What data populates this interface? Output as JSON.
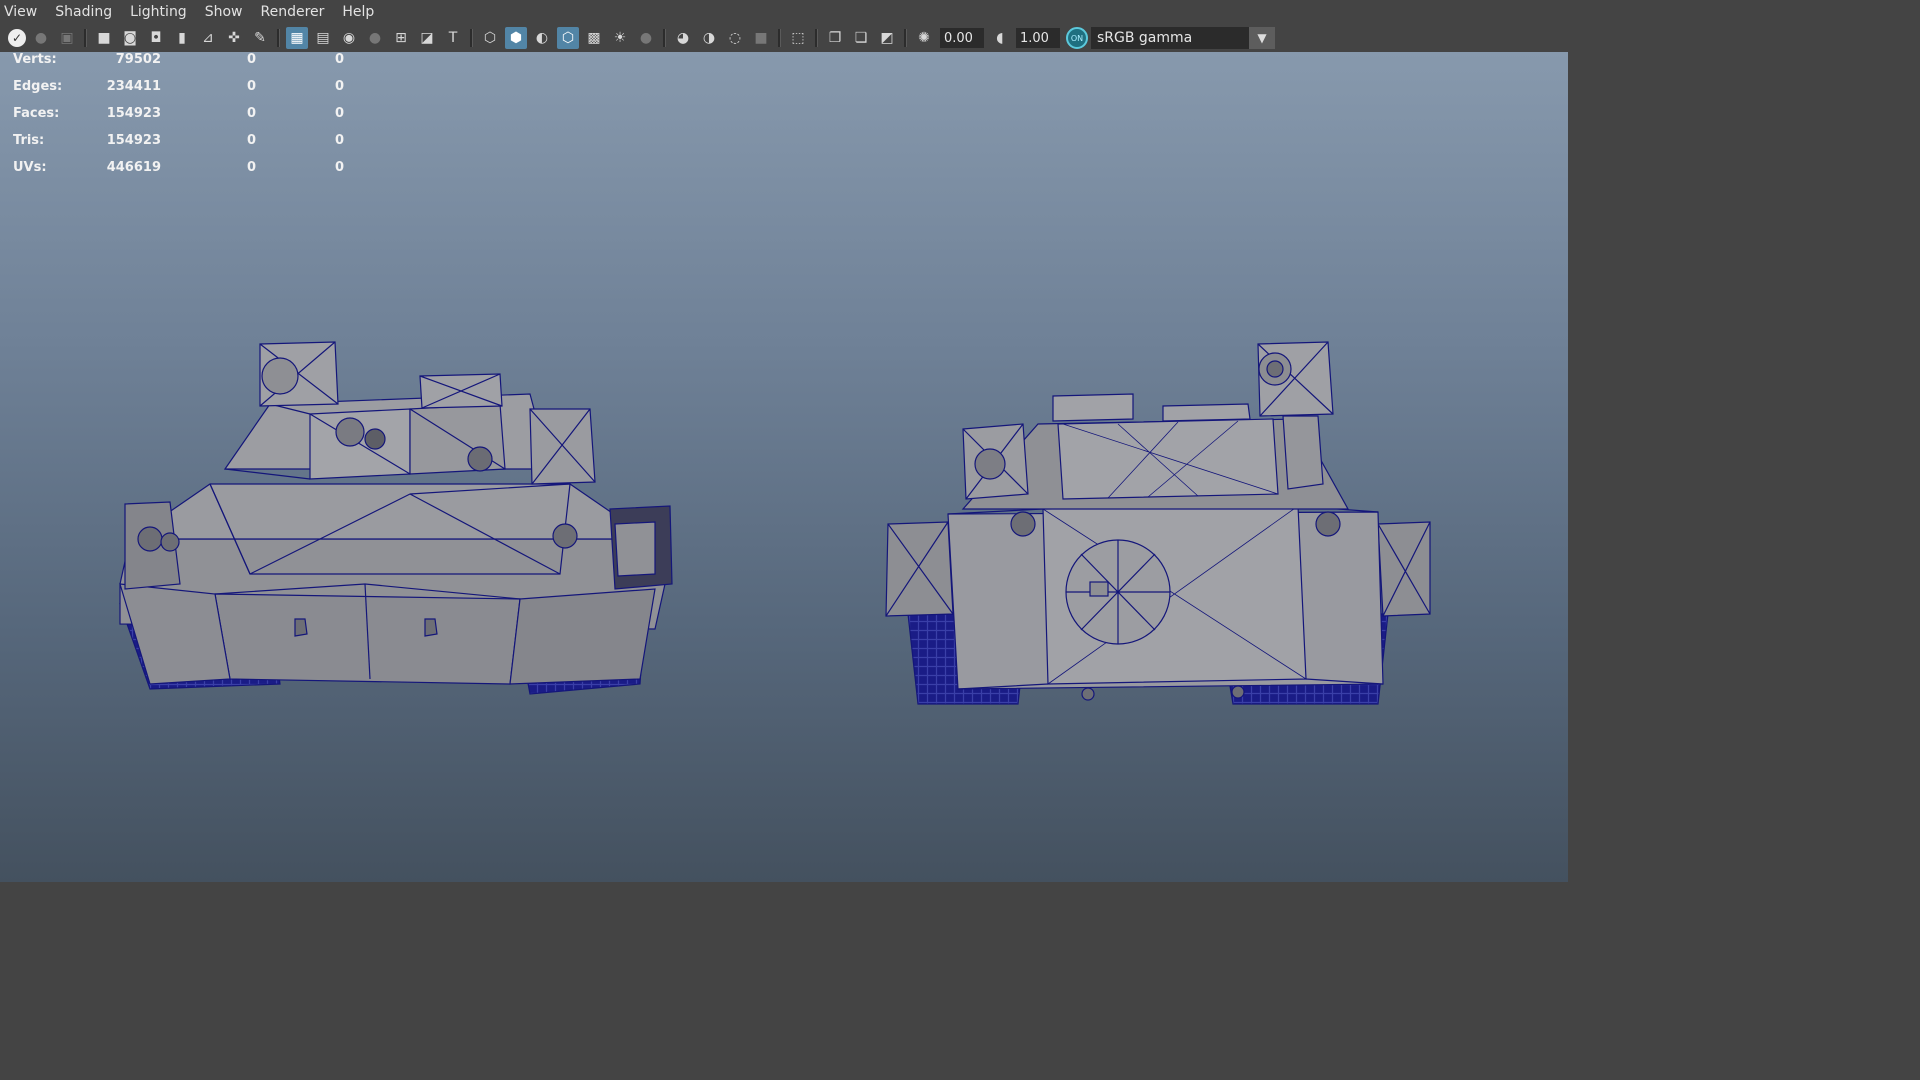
{
  "menu": [
    "View",
    "Shading",
    "Lighting",
    "Show",
    "Renderer",
    "Help"
  ],
  "toolbar": {
    "exposure_value": "0.00",
    "gamma_value": "1.00",
    "color_management_badge": "ON",
    "color_space": "sRGB gamma"
  },
  "hud": {
    "rows": [
      {
        "label": "Verts:",
        "v1": "79502",
        "v2": "0",
        "v3": "0"
      },
      {
        "label": "Edges:",
        "v1": "234411",
        "v2": "0",
        "v3": "0"
      },
      {
        "label": "Faces:",
        "v1": "154923",
        "v2": "0",
        "v3": "0"
      },
      {
        "label": "Tris:",
        "v1": "154923",
        "v2": "0",
        "v3": "0"
      },
      {
        "label": "UVs:",
        "v1": "446619",
        "v2": "0",
        "v3": "0"
      }
    ]
  },
  "colors": {
    "ui_bg": "#444444",
    "accent": "#5285a6",
    "wire": "#14167a",
    "model_fill": "#8f9096"
  },
  "icons": [
    "maya-logo-icon",
    "camera-icon",
    "bookmark-icon",
    "grid-icon",
    "wireframe-cube-icon",
    "smooth-shade-icon",
    "light-icon",
    "shadow-icon",
    "isolate-icon",
    "exposure-icon",
    "gamma-icon",
    "dropdown-arrow-icon"
  ]
}
